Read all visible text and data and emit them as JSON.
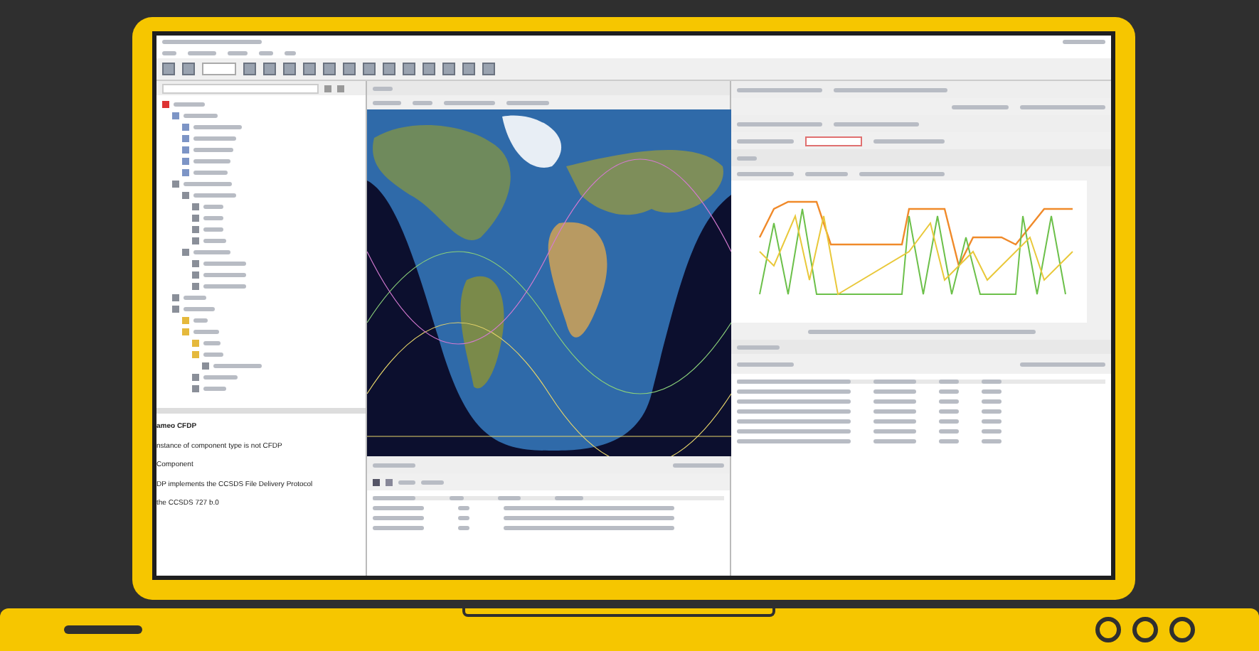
{
  "description": {
    "lines": [
      "ameo CFDP",
      "nstance of component type is not CFDP",
      "Component",
      "DP implements the CCSDS File Delivery Protocol",
      "the CCSDS 727 b.0"
    ]
  }
}
